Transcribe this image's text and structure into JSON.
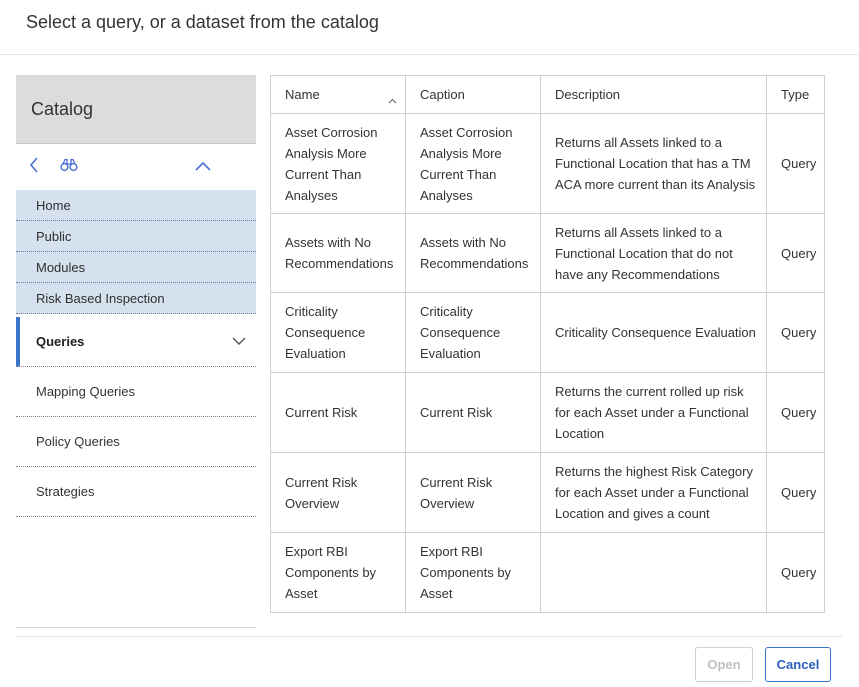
{
  "dialog": {
    "title": "Select a query, or a dataset from the catalog"
  },
  "sidebar": {
    "header": "Catalog",
    "toolbar_icons": [
      "back-chevron-icon",
      "binoculars-icon",
      "collapse-chevron-icon"
    ],
    "breadcrumbs": [
      "Home",
      "Public",
      "Modules",
      "Risk Based Inspection"
    ],
    "selected": "Queries",
    "items": [
      "Mapping Queries",
      "Policy Queries",
      "Strategies"
    ]
  },
  "table": {
    "columns": [
      "Name",
      "Caption",
      "Description",
      "Type"
    ],
    "rows": [
      {
        "name": "Asset Corrosion Analysis More Current Than Analyses",
        "caption": "Asset Corrosion Analysis More Current Than Analyses",
        "description": "Returns all Assets linked to a Functional Location that has a TM ACA more current than its Analysis",
        "type": "Query"
      },
      {
        "name": "Assets with No Recommendations",
        "caption": "Assets with No Recommendations",
        "description": "Returns all Assets linked to a Functional Location that do not have any Recommendations",
        "type": "Query"
      },
      {
        "name": "Criticality Consequence Evaluation",
        "caption": "Criticality Consequence Evaluation",
        "description": "Criticality Consequence Evaluation",
        "type": "Query"
      },
      {
        "name": "Current Risk",
        "caption": "Current Risk",
        "description": "Returns the current rolled up risk for each Asset under a Functional Location",
        "type": "Query"
      },
      {
        "name": "Current Risk Overview",
        "caption": "Current Risk Overview",
        "description": "Returns the highest Risk Category for each Asset under a Functional Location and gives a count",
        "type": "Query"
      },
      {
        "name": "Export RBI Components by Asset",
        "caption": "Export RBI Components by Asset",
        "description": "",
        "type": "Query"
      }
    ]
  },
  "footer": {
    "open_label": "Open",
    "cancel_label": "Cancel"
  },
  "colors": {
    "accent": "#3b73cc",
    "breadcrumb_bg": "#d5e1ee",
    "header_bg": "#dcdcdc"
  }
}
